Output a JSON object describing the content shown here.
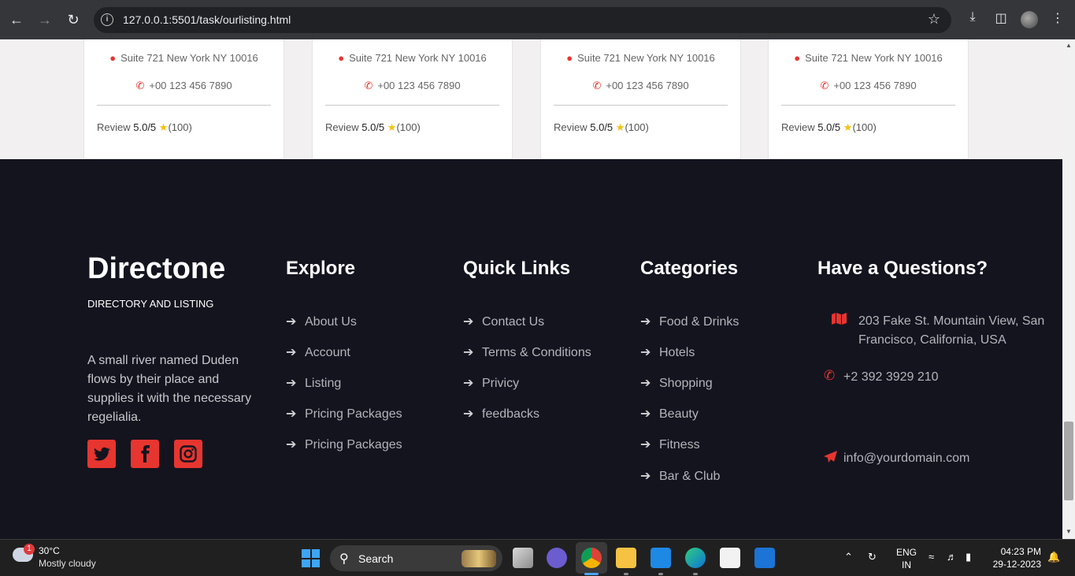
{
  "browser": {
    "url": "127.0.0.1:5501/task/ourlisting.html"
  },
  "cards": [
    {
      "address": "Suite 721 New York NY 10016",
      "phone": "+00 123 456 7890",
      "review_label": "Review",
      "score": "5.0/5",
      "count": "(100)"
    },
    {
      "address": "Suite 721 New York NY 10016",
      "phone": "+00 123 456 7890",
      "review_label": "Review",
      "score": "5.0/5",
      "count": "(100)"
    },
    {
      "address": "Suite 721 New York NY 10016",
      "phone": "+00 123 456 7890",
      "review_label": "Review",
      "score": "5.0/5",
      "count": "(100)"
    },
    {
      "address": "Suite 721 New York NY 10016",
      "phone": "+00 123 456 7890",
      "review_label": "Review",
      "score": "5.0/5",
      "count": "(100)"
    }
  ],
  "footer": {
    "brand": "Directone",
    "tagline": "DIRECTORY AND LISTING",
    "description": "A small river named Duden flows by their place and supplies it with the necessary regelialia.",
    "explore": {
      "title": "Explore",
      "links": [
        "About Us",
        "Account",
        "Listing",
        "Pricing Packages",
        "Pricing Packages"
      ]
    },
    "quick_links": {
      "title": "Quick Links",
      "links": [
        "Contact Us",
        "Terms & Conditions",
        "Privicy",
        "feedbacks"
      ]
    },
    "categories": {
      "title": "Categories",
      "links": [
        "Food & Drinks",
        "Hotels",
        "Shopping",
        "Beauty",
        "Fitness",
        "Bar & Club"
      ]
    },
    "contact": {
      "title": "Have a Questions?",
      "address": "203 Fake St. Mountain View, San Francisco, California, USA",
      "phone": "+2 392 3929 210",
      "email": "info@yourdomain.com"
    },
    "accent_color": "#e7352f"
  },
  "taskbar": {
    "weather_badge": "1",
    "temperature": "30°C",
    "condition": "Mostly cloudy",
    "search_label": "Search",
    "lang_line1": "ENG",
    "lang_line2": "IN",
    "time": "04:23 PM",
    "date": "29-12-2023"
  }
}
